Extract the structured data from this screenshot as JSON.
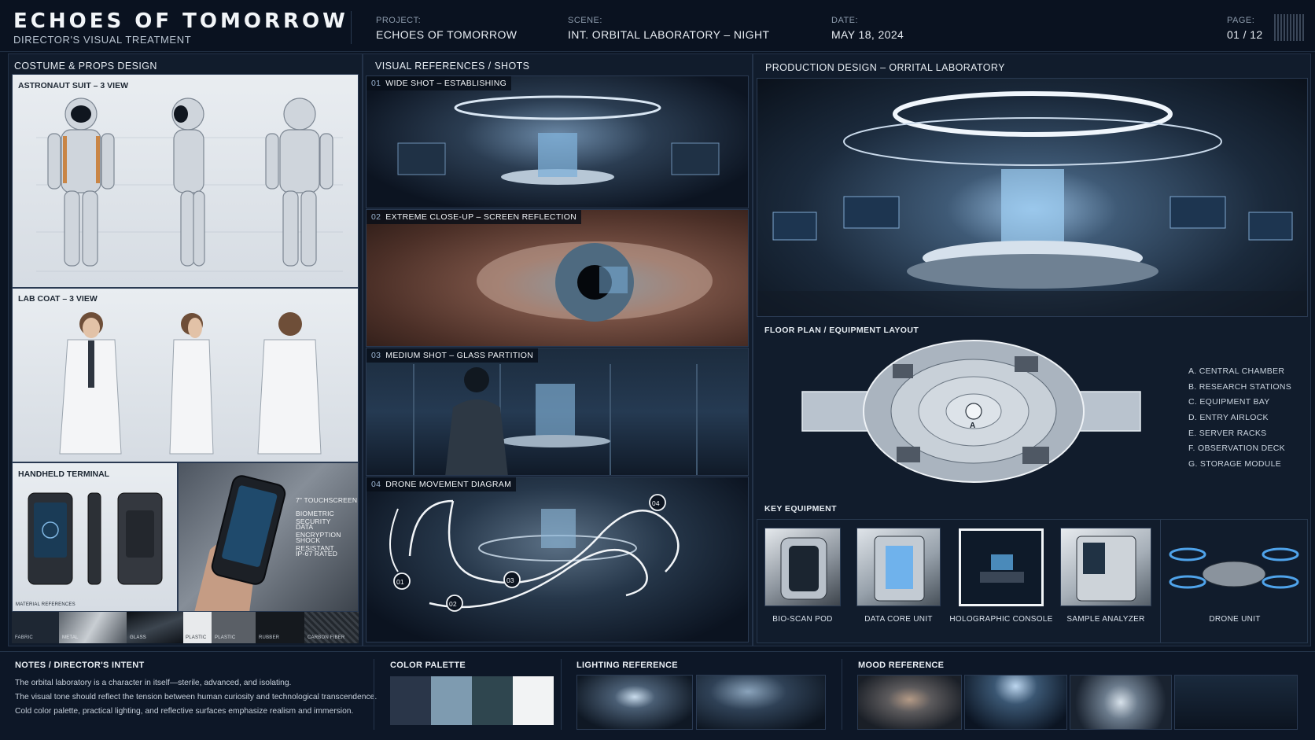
{
  "header": {
    "title": "ECHOES OF TOMORROW",
    "subtitle": "DIRECTOR'S VISUAL TREATMENT",
    "project_label": "PROJECT:",
    "project_value": "ECHOES OF TOMORROW",
    "scene_label": "SCENE:",
    "scene_value": "INT. ORBITAL LABORATORY – NIGHT",
    "date_label": "DATE:",
    "date_value": "MAY 18, 2024",
    "page_label": "PAGE:",
    "page_value": "01 / 12"
  },
  "costume": {
    "title": "COSTUME & PROPS DESIGN",
    "suit_label": "ASTRONAUT SUIT – 3 VIEW",
    "coat_label": "LAB COAT – 3 VIEW",
    "terminal_label": "HANDHELD TERMINAL",
    "terminal_specs": [
      "7\" TOUCHSCREEN",
      "BIOMETRIC SECURITY",
      "DATA ENCRYPTION",
      "SHOCK RESISTANT",
      "IP-67 RATED"
    ],
    "material_label": "MATERIAL REFERENCES",
    "materials": [
      "FABRIC",
      "METAL",
      "GLASS",
      "PLASTIC",
      "PLASTIC",
      "RUBBER",
      "CARBON FIBER"
    ]
  },
  "shots": {
    "title": "VISUAL REFERENCES / SHOTS",
    "items": [
      {
        "num": "01",
        "label": "WIDE SHOT – ESTABLISHING"
      },
      {
        "num": "02",
        "label": "EXTREME CLOSE-UP – SCREEN REFLECTION"
      },
      {
        "num": "03",
        "label": "MEDIUM SHOT – GLASS PARTITION"
      },
      {
        "num": "04",
        "label": "DRONE MOVEMENT DIAGRAM"
      }
    ],
    "drone_markers": [
      "01",
      "02",
      "03",
      "04"
    ]
  },
  "production": {
    "title": "PRODUCTION DESIGN – ORRITAL LABORATORY",
    "floorplan_title": "FLOOR PLAN / EQUIPMENT LAYOUT",
    "center_marker": "A",
    "legend": [
      "A.  CENTRAL CHAMBER",
      "B.  RESEARCH STATIONS",
      "C.  EQUIPMENT BAY",
      "D.  ENTRY AIRLOCK",
      "E.  SERVER RACKS",
      "F.  OBSERVATION DECK",
      "G.  STORAGE MODULE"
    ],
    "equipment_title": "KEY EQUIPMENT",
    "equipment": [
      "BIO-SCAN POD",
      "DATA CORE UNIT",
      "HOLOGRAPHIC CONSOLE",
      "SAMPLE ANALYZER",
      "DRONE UNIT"
    ]
  },
  "footer": {
    "notes_title": "NOTES / DIRECTOR'S INTENT",
    "notes": [
      "The orbital laboratory is a character in itself—sterile, advanced, and isolating.",
      "The visual tone should reflect the tension between human curiosity and technological transcendence.",
      "Cold color palette, practical lighting, and reflective surfaces emphasize realism and immersion."
    ],
    "palette_title": "COLOR PALETTE",
    "palette": [
      "#2a3649",
      "#7e9bb0",
      "#2f464f",
      "#f2f3f4"
    ],
    "lighting_title": "LIGHTING REFERENCE",
    "mood_title": "MOOD REFERENCE"
  }
}
